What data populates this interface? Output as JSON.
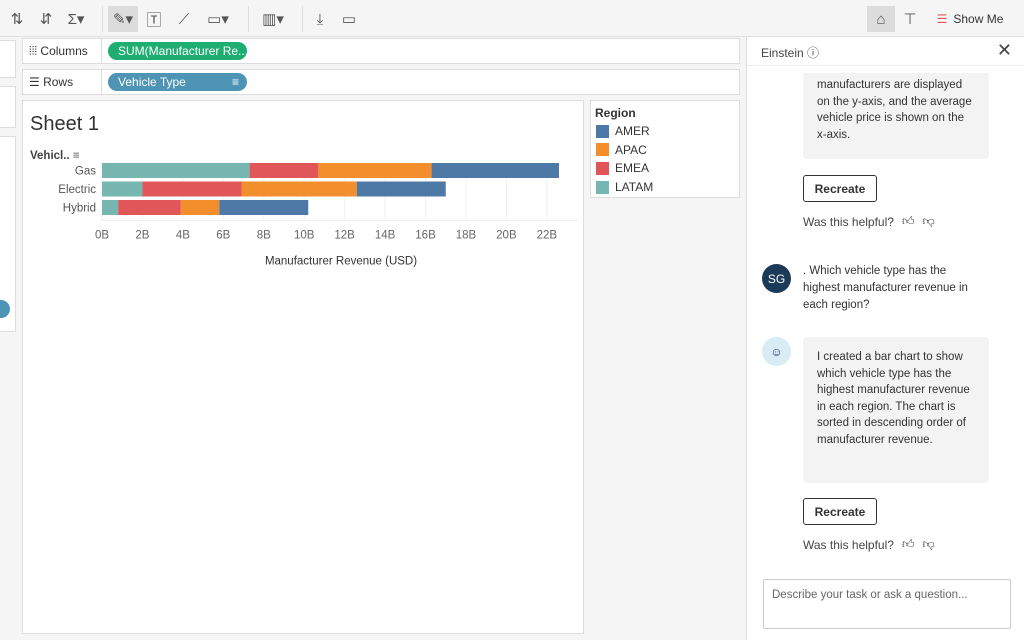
{
  "toolbar": {
    "show_me": "Show Me",
    "icons": [
      "sort-ascending-icon",
      "sort-descending-icon",
      "sum-icon",
      "highlight-icon",
      "text-label-icon",
      "annotate-icon",
      "fit-icon",
      "chart-type-icon",
      "download-icon",
      "presentation-icon",
      "einstein-icon",
      "pin-icon",
      "show-me-icon"
    ]
  },
  "shelves": {
    "columns_label": "Columns",
    "columns_pill": "SUM(Manufacturer Re...",
    "rows_label": "Rows",
    "rows_pill": "Vehicle Type",
    "columns_color": "#1fae72",
    "rows_color": "#4e94b4"
  },
  "sheet": {
    "title": "Sheet 1"
  },
  "chart_data": {
    "type": "bar",
    "orientation": "horizontal",
    "stacked": true,
    "ylabel": "Vehicl..",
    "xlabel": "Manufacturer Revenue (USD)",
    "categories": [
      "Gas",
      "Electric",
      "Hybrid"
    ],
    "xlim": [
      0,
      23
    ],
    "xticks": [
      "0B",
      "2B",
      "4B",
      "6B",
      "8B",
      "10B",
      "12B",
      "14B",
      "16B",
      "18B",
      "20B",
      "22B"
    ],
    "grid": true,
    "series": [
      {
        "name": "LATAM",
        "color": "#76b7b2",
        "values": [
          7.3,
          2.0,
          0.8
        ]
      },
      {
        "name": "EMEA",
        "color": "#e15759",
        "values": [
          3.4,
          4.9,
          3.1
        ]
      },
      {
        "name": "APAC",
        "color": "#f28e2b",
        "values": [
          5.6,
          5.7,
          1.9
        ]
      },
      {
        "name": "AMER",
        "color": "#4e79a7",
        "values": [
          6.3,
          4.4,
          4.4
        ]
      }
    ]
  },
  "legend": {
    "title": "Region",
    "items": [
      {
        "label": "AMER",
        "color": "#4e79a7"
      },
      {
        "label": "APAC",
        "color": "#f28e2b"
      },
      {
        "label": "EMEA",
        "color": "#e15759"
      },
      {
        "label": "LATAM",
        "color": "#76b7b2"
      }
    ]
  },
  "einstein": {
    "title": "Einstein",
    "msg1": "manufacturers are displayed on the y-axis, and the average vehicle price is shown on the x-axis.",
    "recreate": "Recreate",
    "helpful": "Was this helpful?",
    "user_initials": "SG",
    "user_msg": ". Which vehicle type has the highest manufacturer revenue in each region?",
    "msg2": "I created a bar chart to show which vehicle type has the highest manufacturer revenue in each region. The chart is sorted in descending order of manufacturer revenue.",
    "input_placeholder": "Describe your task or ask a question..."
  }
}
